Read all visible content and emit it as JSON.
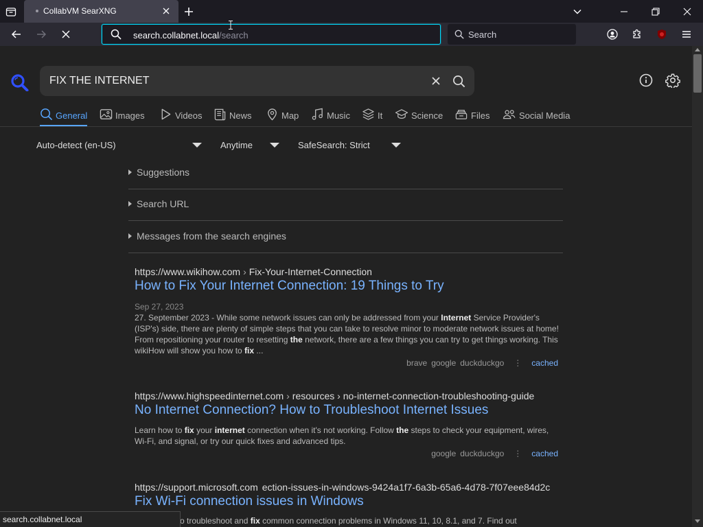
{
  "browser": {
    "tab": {
      "title": "CollabVM SearXNG",
      "close": "Close tab"
    },
    "url": {
      "host": "search.collabnet.local",
      "path": "/search"
    },
    "search_placeholder": "Search",
    "status_url": "search.collabnet.local"
  },
  "page": {
    "query": "FIX THE INTERNET",
    "categories": [
      {
        "label": "General",
        "icon": "search-icon",
        "active": true
      },
      {
        "label": "Images",
        "icon": "image-icon"
      },
      {
        "label": "Videos",
        "icon": "play-icon"
      },
      {
        "label": "News",
        "icon": "newspaper-icon"
      },
      {
        "label": "Map",
        "icon": "map-pin-icon"
      },
      {
        "label": "Music",
        "icon": "music-note-icon"
      },
      {
        "label": "It",
        "icon": "layers-icon"
      },
      {
        "label": "Science",
        "icon": "school-icon"
      },
      {
        "label": "Files",
        "icon": "file-tray-icon"
      },
      {
        "label": "Social Media",
        "icon": "people-icon"
      }
    ],
    "filters": {
      "language": "Auto-detect (en-US)",
      "time": "Anytime",
      "safesearch": "SafeSearch: Strict"
    },
    "sections": [
      "Suggestions",
      "Search URL",
      "Messages from the search engines"
    ],
    "results": [
      {
        "host": "https://www.wikihow.com",
        "path": "Fix-Your-Internet-Connection",
        "title": "How to Fix Your Internet Connection: 19 Things to Try",
        "date": "Sep 27, 2023",
        "snippet": [
          {
            "t": "27. September 2023 - While some network issues can only be addressed from your "
          },
          {
            "t": "Internet",
            "b": true
          },
          {
            "t": " Service Provider's (ISP's) side, there are plenty of simple steps that you can take to resolve minor to moderate network issues at home! From repositioning your router to resetting "
          },
          {
            "t": "the",
            "b": true
          },
          {
            "t": " network, there are a few things you can try to get things working. This wikiHow will show you how to "
          },
          {
            "t": "fix",
            "b": true
          },
          {
            "t": " ..."
          }
        ],
        "engines": [
          "brave",
          "google",
          "duckduckgo"
        ],
        "cached": "cached"
      },
      {
        "host": "https://www.highspeedinternet.com",
        "path": "resources › no-internet-connection-troubleshooting-guide",
        "title": "No Internet Connection? How to Troubleshoot Internet Issues",
        "snippet": [
          {
            "t": "Learn how to "
          },
          {
            "t": "fix",
            "b": true
          },
          {
            "t": " your "
          },
          {
            "t": "internet",
            "b": true
          },
          {
            "t": " connection when it's not working. Follow "
          },
          {
            "t": "the",
            "b": true
          },
          {
            "t": " steps to check your equipment, wires, Wi-Fi, and signal, or try our quick fixes and advanced tips."
          }
        ],
        "engines": [
          "google",
          "duckduckgo"
        ],
        "cached": "cached"
      },
      {
        "host": "https://support.microsoft.com",
        "path": "ection-issues-in-windows-9424a1f7-6a3b-65a6-4d78-7f07eee84d2c",
        "title": "Fix Wi-Fi connection issues in Windows",
        "snippet_visible": "o troubleshoot and ",
        "snippet_bold": "fix",
        "snippet_rest": " common connection problems in Windows 11, 10, 8.1, and 7. Find out"
      }
    ]
  },
  "colors": {
    "accent": "#58a6ff",
    "link": "#79b3ff",
    "url_focus": "#00ddff",
    "background": "#222222"
  }
}
